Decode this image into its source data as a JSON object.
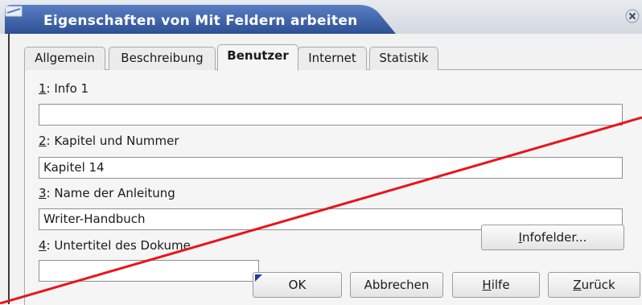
{
  "window": {
    "title": "Eigenschaften von Mit Feldern arbeiten",
    "app_icon": "document-icon",
    "close_icon": "close-icon"
  },
  "tabs": [
    {
      "label": "Allgemein",
      "active": false
    },
    {
      "label": "Beschreibung",
      "active": false
    },
    {
      "label": "Benutzer",
      "active": true
    },
    {
      "label": "Internet",
      "active": false
    },
    {
      "label": "Statistik",
      "active": false
    }
  ],
  "fields": [
    {
      "mnemonic": "1",
      "label": ": Info 1",
      "value": ""
    },
    {
      "mnemonic": "2",
      "label": ": Kapitel und Nummer",
      "value": "Kapitel 14"
    },
    {
      "mnemonic": "3",
      "label": ": Name der Anleitung",
      "value": "Writer-Handbuch"
    },
    {
      "mnemonic": "4",
      "label": ": Untertitel des Dokume",
      "value": ""
    }
  ],
  "buttons": {
    "infofelder": "Infofelder...",
    "infofelder_mnemonic": "I",
    "infofelder_rest": "nfofelder...",
    "ok": "OK",
    "abbrechen": "Abbrechen",
    "hilfe_mnemonic": "H",
    "hilfe_rest": "ilfe",
    "zurueck_mnemonic": "Z",
    "zurueck_rest": "urück"
  },
  "colors": {
    "title_bar_active": "#3b5fa8",
    "annotation_line": "#e8141b"
  }
}
